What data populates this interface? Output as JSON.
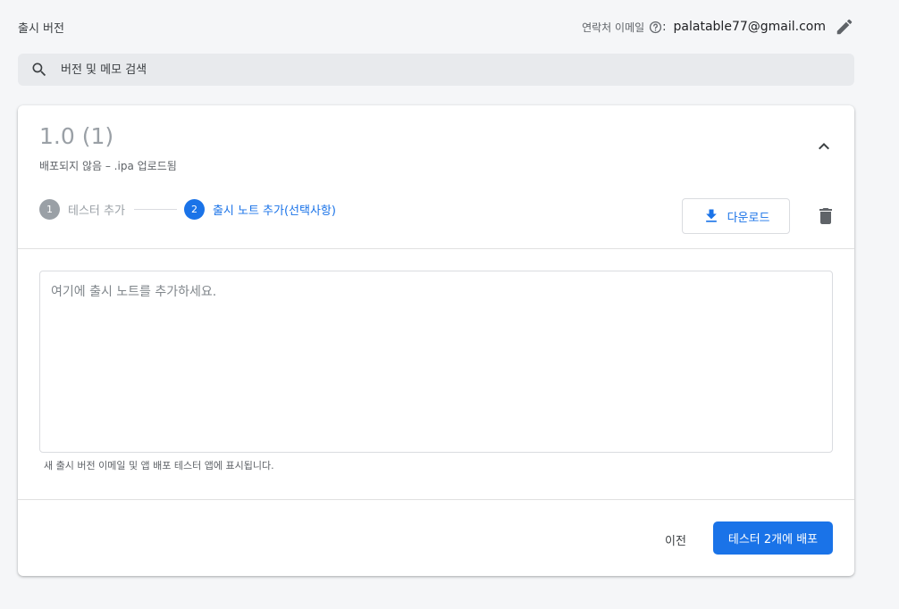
{
  "header": {
    "title": "출시 버전",
    "contact_label": "연락처 이메일",
    "colon": ":",
    "email": "palatable77@gmail.com",
    "help_icon": "help-circle-icon",
    "edit_icon": "pencil-icon"
  },
  "search": {
    "placeholder": "버전 및 메모 검색",
    "icon": "search-icon"
  },
  "release": {
    "version": "1.0 (1)",
    "subtitle": "배포되지 않음 – .ipa 업로드됨",
    "steps": [
      {
        "number": "1",
        "label": "테스터 추가",
        "state": "done"
      },
      {
        "number": "2",
        "label": "출시 노트 추가(선택사항)",
        "state": "active"
      }
    ],
    "download_label": "다운로드",
    "notes_placeholder": "여기에 출시 노트를 추가하세요.",
    "notes_hint": "새 출시 버전 이메일 및 앱 배포 테스터 앱에 표시됩니다.",
    "prev_label": "이전",
    "deploy_label": "테스터 2개에 배포"
  },
  "colors": {
    "accent": "#1a73e8",
    "muted": "#9aa0a6",
    "background": "#f5f6f8",
    "card": "#ffffff"
  }
}
